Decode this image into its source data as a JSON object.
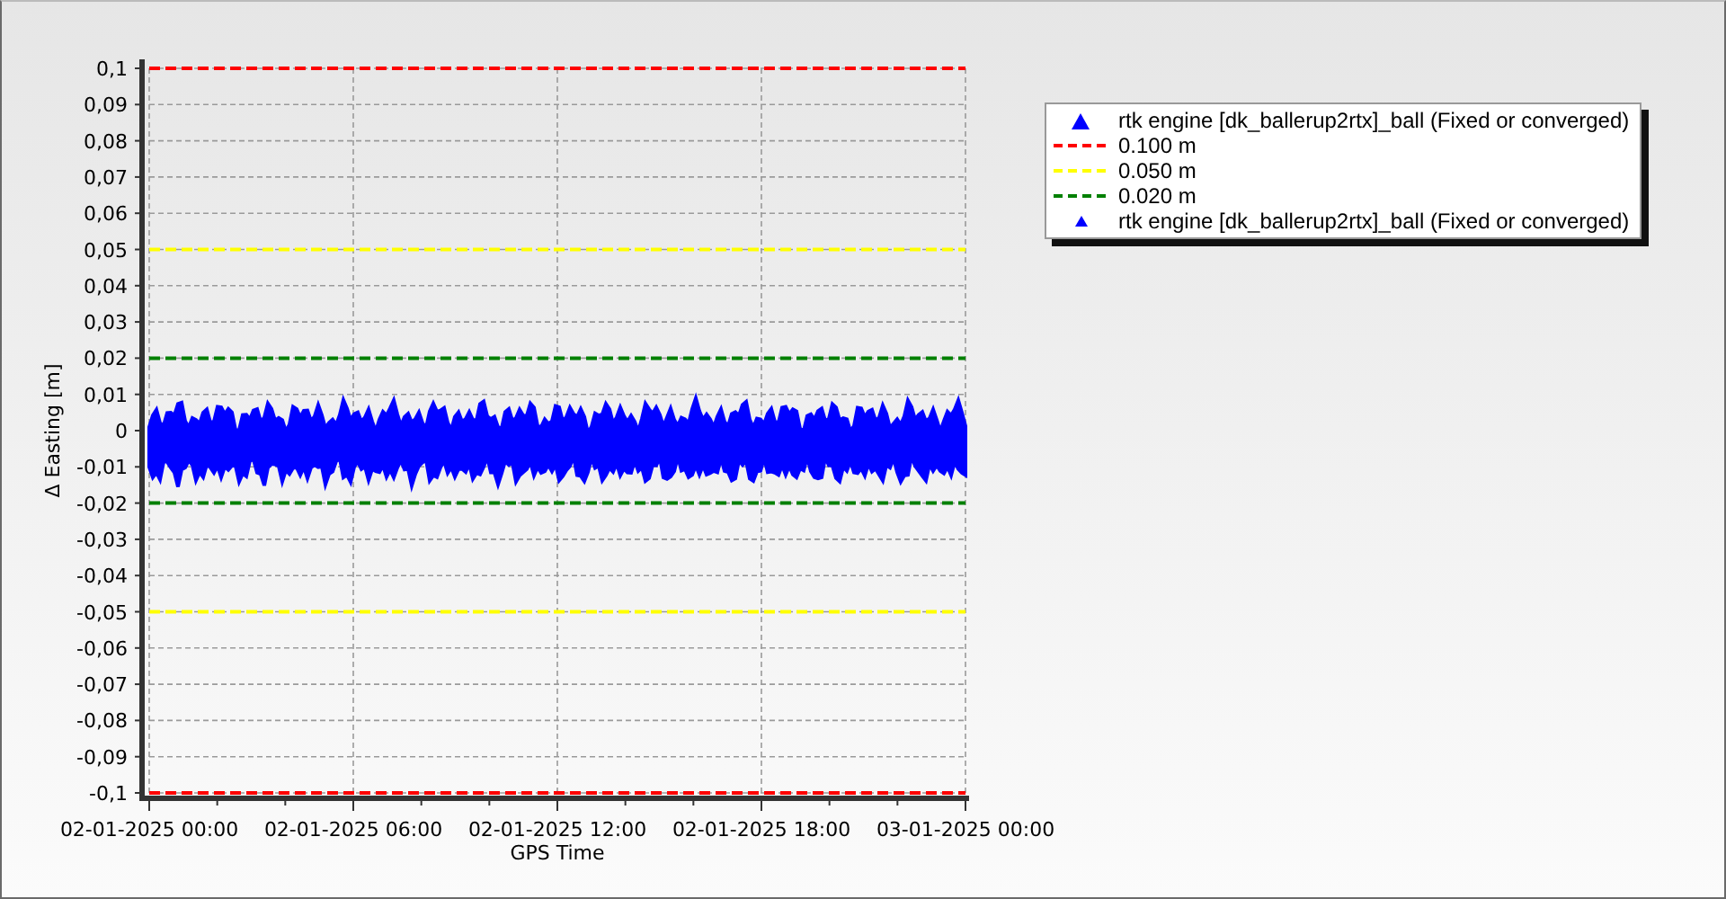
{
  "chart": {
    "chart_data": {
      "type": "line",
      "xlabel": "GPS Time",
      "ylabel": "Δ Easting [m]",
      "categories": [
        "02-01-2025 00:00",
        "02-01-2025 06:00",
        "02-01-2025 12:00",
        "02-01-2025 18:00",
        "03-01-2025 00:00"
      ],
      "ylim": [
        -0.1,
        0.1
      ],
      "yticks": [
        {
          "value": 0.1,
          "label": "0,1"
        },
        {
          "value": 0.09,
          "label": "0,09"
        },
        {
          "value": 0.08,
          "label": "0,08"
        },
        {
          "value": 0.07,
          "label": "0,07"
        },
        {
          "value": 0.06,
          "label": "0,06"
        },
        {
          "value": 0.05,
          "label": "0,05"
        },
        {
          "value": 0.04,
          "label": "0,04"
        },
        {
          "value": 0.03,
          "label": "0,03"
        },
        {
          "value": 0.02,
          "label": "0,02"
        },
        {
          "value": 0.01,
          "label": "0,01"
        },
        {
          "value": 0,
          "label": "0"
        },
        {
          "value": -0.01,
          "label": "-0,01"
        },
        {
          "value": -0.02,
          "label": "-0,02"
        },
        {
          "value": -0.03,
          "label": "-0,03"
        },
        {
          "value": -0.04,
          "label": "-0,04"
        },
        {
          "value": -0.05,
          "label": "-0,05"
        },
        {
          "value": -0.06,
          "label": "-0,06"
        },
        {
          "value": -0.07,
          "label": "-0,07"
        },
        {
          "value": -0.08,
          "label": "-0,08"
        },
        {
          "value": -0.09,
          "label": "-0,09"
        },
        {
          "value": -0.1,
          "label": "-0,1"
        }
      ],
      "series": [
        {
          "name": "0.100 m",
          "color": "#ff0000",
          "line_style": "dashed",
          "values": [
            0.1,
            0.1,
            0.1,
            0.1,
            0.1
          ]
        },
        {
          "name": "0.050 m",
          "color": "#ffff00",
          "line_style": "dashed",
          "values": [
            0.05,
            0.05,
            0.05,
            0.05,
            0.05
          ]
        },
        {
          "name": "0.020 m",
          "color": "#008000",
          "line_style": "dashed",
          "values": [
            0.02,
            0.02,
            0.02,
            0.02,
            0.02
          ]
        }
      ],
      "grid": true,
      "ref_lines": [
        {
          "axis": "y",
          "value": -0.1,
          "color": "#ff0000",
          "line_style": "dashed"
        },
        {
          "axis": "y",
          "value": -0.05,
          "color": "#ffff00",
          "line_style": "dashed"
        },
        {
          "axis": "y",
          "value": -0.02,
          "color": "#008000",
          "line_style": "dashed"
        }
      ]
    }
  },
  "legend": [
    {
      "kind": "large-marker",
      "color": "#0000ff",
      "label": "rtk engine [dk_ballerup2rtx]_ball (Fixed or converged)"
    },
    {
      "kind": "small-marker",
      "color": "#0000ff",
      "label": "rtk engine [dk_ballerup2rtx]_ball (Fixed or converged)"
    }
  ]
}
